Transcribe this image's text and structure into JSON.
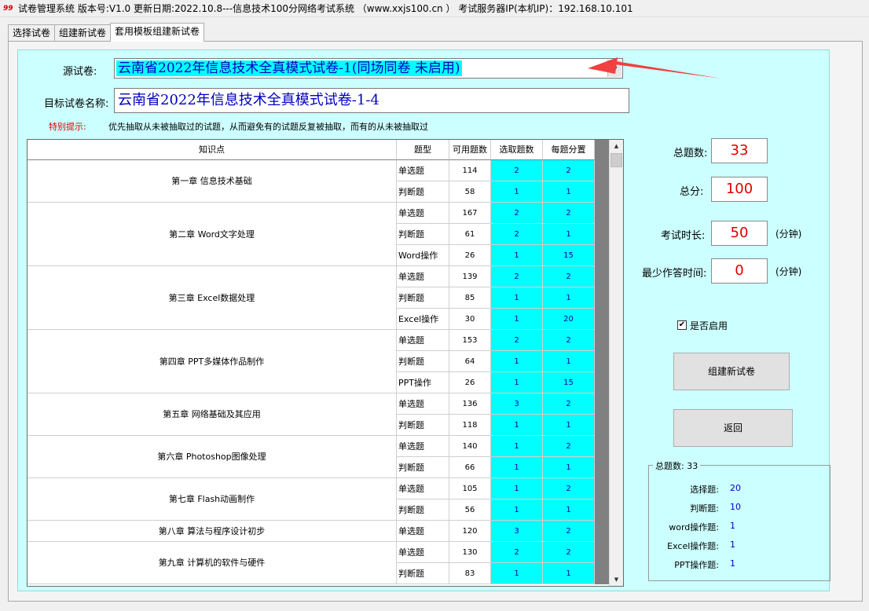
{
  "window": {
    "title": "试卷管理系统 版本号:V1.0 更新日期:2022.10.8---信息技术100分网络考试系统  （www.xxjs100.cn ）  考试服务器IP(本机IP)：192.168.10.101",
    "icon_text": "99"
  },
  "tabs": [
    "选择试卷",
    "组建新试卷",
    "套用模板组建新试卷"
  ],
  "active_tab": 2,
  "form": {
    "source_label": "源试卷:",
    "source_value": "云南省2022年信息技术全真模式试卷-1(同场同卷 未启用)",
    "target_label": "目标试卷名称:",
    "target_value": "云南省2022年信息技术全真模式试卷-1-4",
    "tip_label": "特别提示:",
    "tip_text": "优先抽取从未被抽取过的试题，从而避免有的试题反复被抽取，而有的从未被抽取过"
  },
  "table": {
    "headers": [
      "知识点",
      "题型",
      "可用题数",
      "选取题数",
      "每题分置"
    ],
    "chapters": [
      {
        "name": "第一章 信息技术基础",
        "rows": [
          {
            "type": "单选题",
            "available": "114",
            "selected": "2",
            "score": "2"
          },
          {
            "type": "判断题",
            "available": "58",
            "selected": "1",
            "score": "1"
          }
        ]
      },
      {
        "name": "第二章 Word文字处理",
        "rows": [
          {
            "type": "单选题",
            "available": "167",
            "selected": "2",
            "score": "2"
          },
          {
            "type": "判断题",
            "available": "61",
            "selected": "2",
            "score": "1"
          },
          {
            "type": "Word操作",
            "available": "26",
            "selected": "1",
            "score": "15"
          }
        ]
      },
      {
        "name": "第三章 Excel数据处理",
        "rows": [
          {
            "type": "单选题",
            "available": "139",
            "selected": "2",
            "score": "2"
          },
          {
            "type": "判断题",
            "available": "85",
            "selected": "1",
            "score": "1"
          },
          {
            "type": "Excel操作",
            "available": "30",
            "selected": "1",
            "score": "20"
          }
        ]
      },
      {
        "name": "第四章 PPT多媒体作品制作",
        "rows": [
          {
            "type": "单选题",
            "available": "153",
            "selected": "2",
            "score": "2"
          },
          {
            "type": "判断题",
            "available": "64",
            "selected": "1",
            "score": "1"
          },
          {
            "type": "PPT操作",
            "available": "26",
            "selected": "1",
            "score": "15"
          }
        ]
      },
      {
        "name": "第五章 网络基础及其应用",
        "rows": [
          {
            "type": "单选题",
            "available": "136",
            "selected": "3",
            "score": "2"
          },
          {
            "type": "判断题",
            "available": "118",
            "selected": "1",
            "score": "1"
          }
        ]
      },
      {
        "name": "第六章 Photoshop图像处理",
        "rows": [
          {
            "type": "单选题",
            "available": "140",
            "selected": "1",
            "score": "2"
          },
          {
            "type": "判断题",
            "available": "66",
            "selected": "1",
            "score": "1"
          }
        ]
      },
      {
        "name": "第七章 Flash动画制作",
        "rows": [
          {
            "type": "单选题",
            "available": "105",
            "selected": "1",
            "score": "2"
          },
          {
            "type": "判断题",
            "available": "56",
            "selected": "1",
            "score": "1"
          }
        ]
      },
      {
        "name": "第八章 算法与程序设计初步",
        "rows": [
          {
            "type": "单选题",
            "available": "120",
            "selected": "3",
            "score": "2"
          }
        ]
      },
      {
        "name": "第九章 计算机的软件与硬件",
        "rows": [
          {
            "type": "单选题",
            "available": "130",
            "selected": "2",
            "score": "2"
          },
          {
            "type": "判断题",
            "available": "83",
            "selected": "1",
            "score": "1"
          }
        ]
      }
    ]
  },
  "side": {
    "total_count_label": "总题数:",
    "total_count": "33",
    "total_score_label": "总分:",
    "total_score": "100",
    "duration_label": "考试时长:",
    "duration": "50",
    "min_time_label": "最少作答时间:",
    "min_time": "0",
    "unit": "(分钟)",
    "enable_label": "是否启用",
    "enable_checked": true,
    "build_button": "组建新试卷",
    "back_button": "返回"
  },
  "summary": {
    "legend": "总题数: 33",
    "items": [
      {
        "label": "选择题:",
        "value": "20"
      },
      {
        "label": "判断题:",
        "value": "10"
      },
      {
        "label": "word操作题:",
        "value": "1"
      },
      {
        "label": "Excel操作题:",
        "value": "1"
      },
      {
        "label": "PPT操作题:",
        "value": "1"
      }
    ]
  },
  "colors": {
    "cyan_panel": "#ccffff",
    "cyan_cell": "#00ffff",
    "value_blue": "#0000c0",
    "alert_red": "#e00000"
  }
}
